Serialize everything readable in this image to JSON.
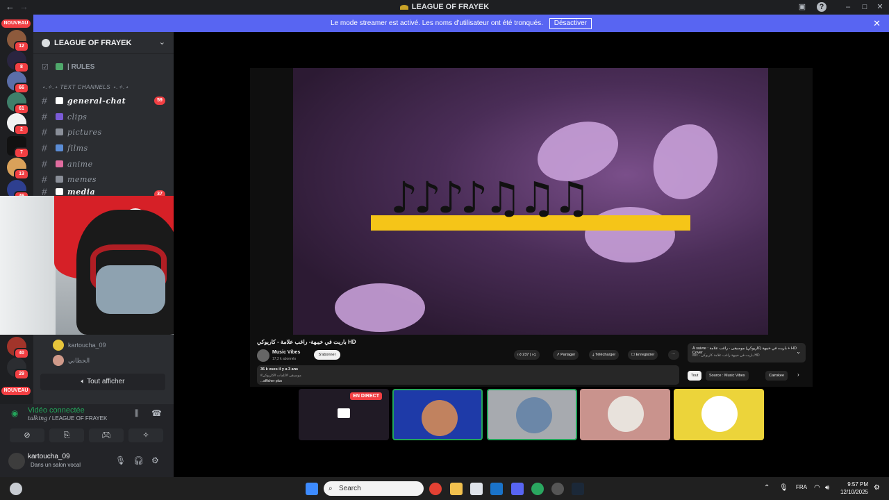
{
  "window": {
    "title": "LEAGUE OF FRAYEK"
  },
  "banner": {
    "text": "Le mode streamer est activé. Les noms d'utilisateur ont été tronqués.",
    "button": "Désactiver"
  },
  "servers": {
    "new_label": "NOUVEAU",
    "badges": [
      "26",
      "12",
      "8",
      "66",
      "61",
      "2",
      "7",
      "13",
      "46",
      "40",
      "29"
    ]
  },
  "guild": {
    "name": "LEAGUE OF FRAYEK",
    "rules": "| RULES",
    "category": "⋆.✧.⋆ TEXT CHANNELS ⋆.✧.⋆",
    "channels": [
      {
        "label": "general-chat",
        "count": "59"
      },
      {
        "label": "clips"
      },
      {
        "label": "pictures"
      },
      {
        "label": "films"
      },
      {
        "label": "anime"
      },
      {
        "label": "memes"
      },
      {
        "label": "media",
        "count": "37"
      }
    ]
  },
  "voice_users": [
    {
      "name": "kartoucha_09"
    },
    {
      "name": "الحطاني"
    }
  ],
  "show_all": "Tout afficher",
  "voice_panel": {
    "status": "Vidéo connectée",
    "channel_prefix": "talking",
    "channel_server": "/ LEAGUE OF FRAYEK"
  },
  "user": {
    "name": "kartoucha_09",
    "status": "Dans un salon vocal"
  },
  "youtube": {
    "title": "باريت في خيبهة- راغب علامة - كاريوكي HD",
    "channel": "Music Vibes",
    "subscribers": "17,2 k abonnés",
    "subscribe": "S'abonner",
    "likes": "237",
    "share": "Partager",
    "download": "Télécharger",
    "save": "Enregistrer",
    "views": "36 k vues  il y a 3 ans",
    "desc_line1": "#موسيقى #كلمات #كاريوكي",
    "desc_line2": "...afficher plus",
    "next_label": "À suivre : باريت في خيبهة (كاريوكي) موسيقى - راغب علامة + HD Cover",
    "next_sub": "Mix - باريت في خيبهة راغب علامة كاريوكي HD",
    "chips": [
      "Tout",
      "Source : Music Vibes",
      "Cairokee"
    ]
  },
  "tiles": {
    "live": "EN DIRECT"
  },
  "taskbar": {
    "search": "Search",
    "lang": "FRA",
    "time": "9:57 PM",
    "date": "12/10/2025"
  }
}
